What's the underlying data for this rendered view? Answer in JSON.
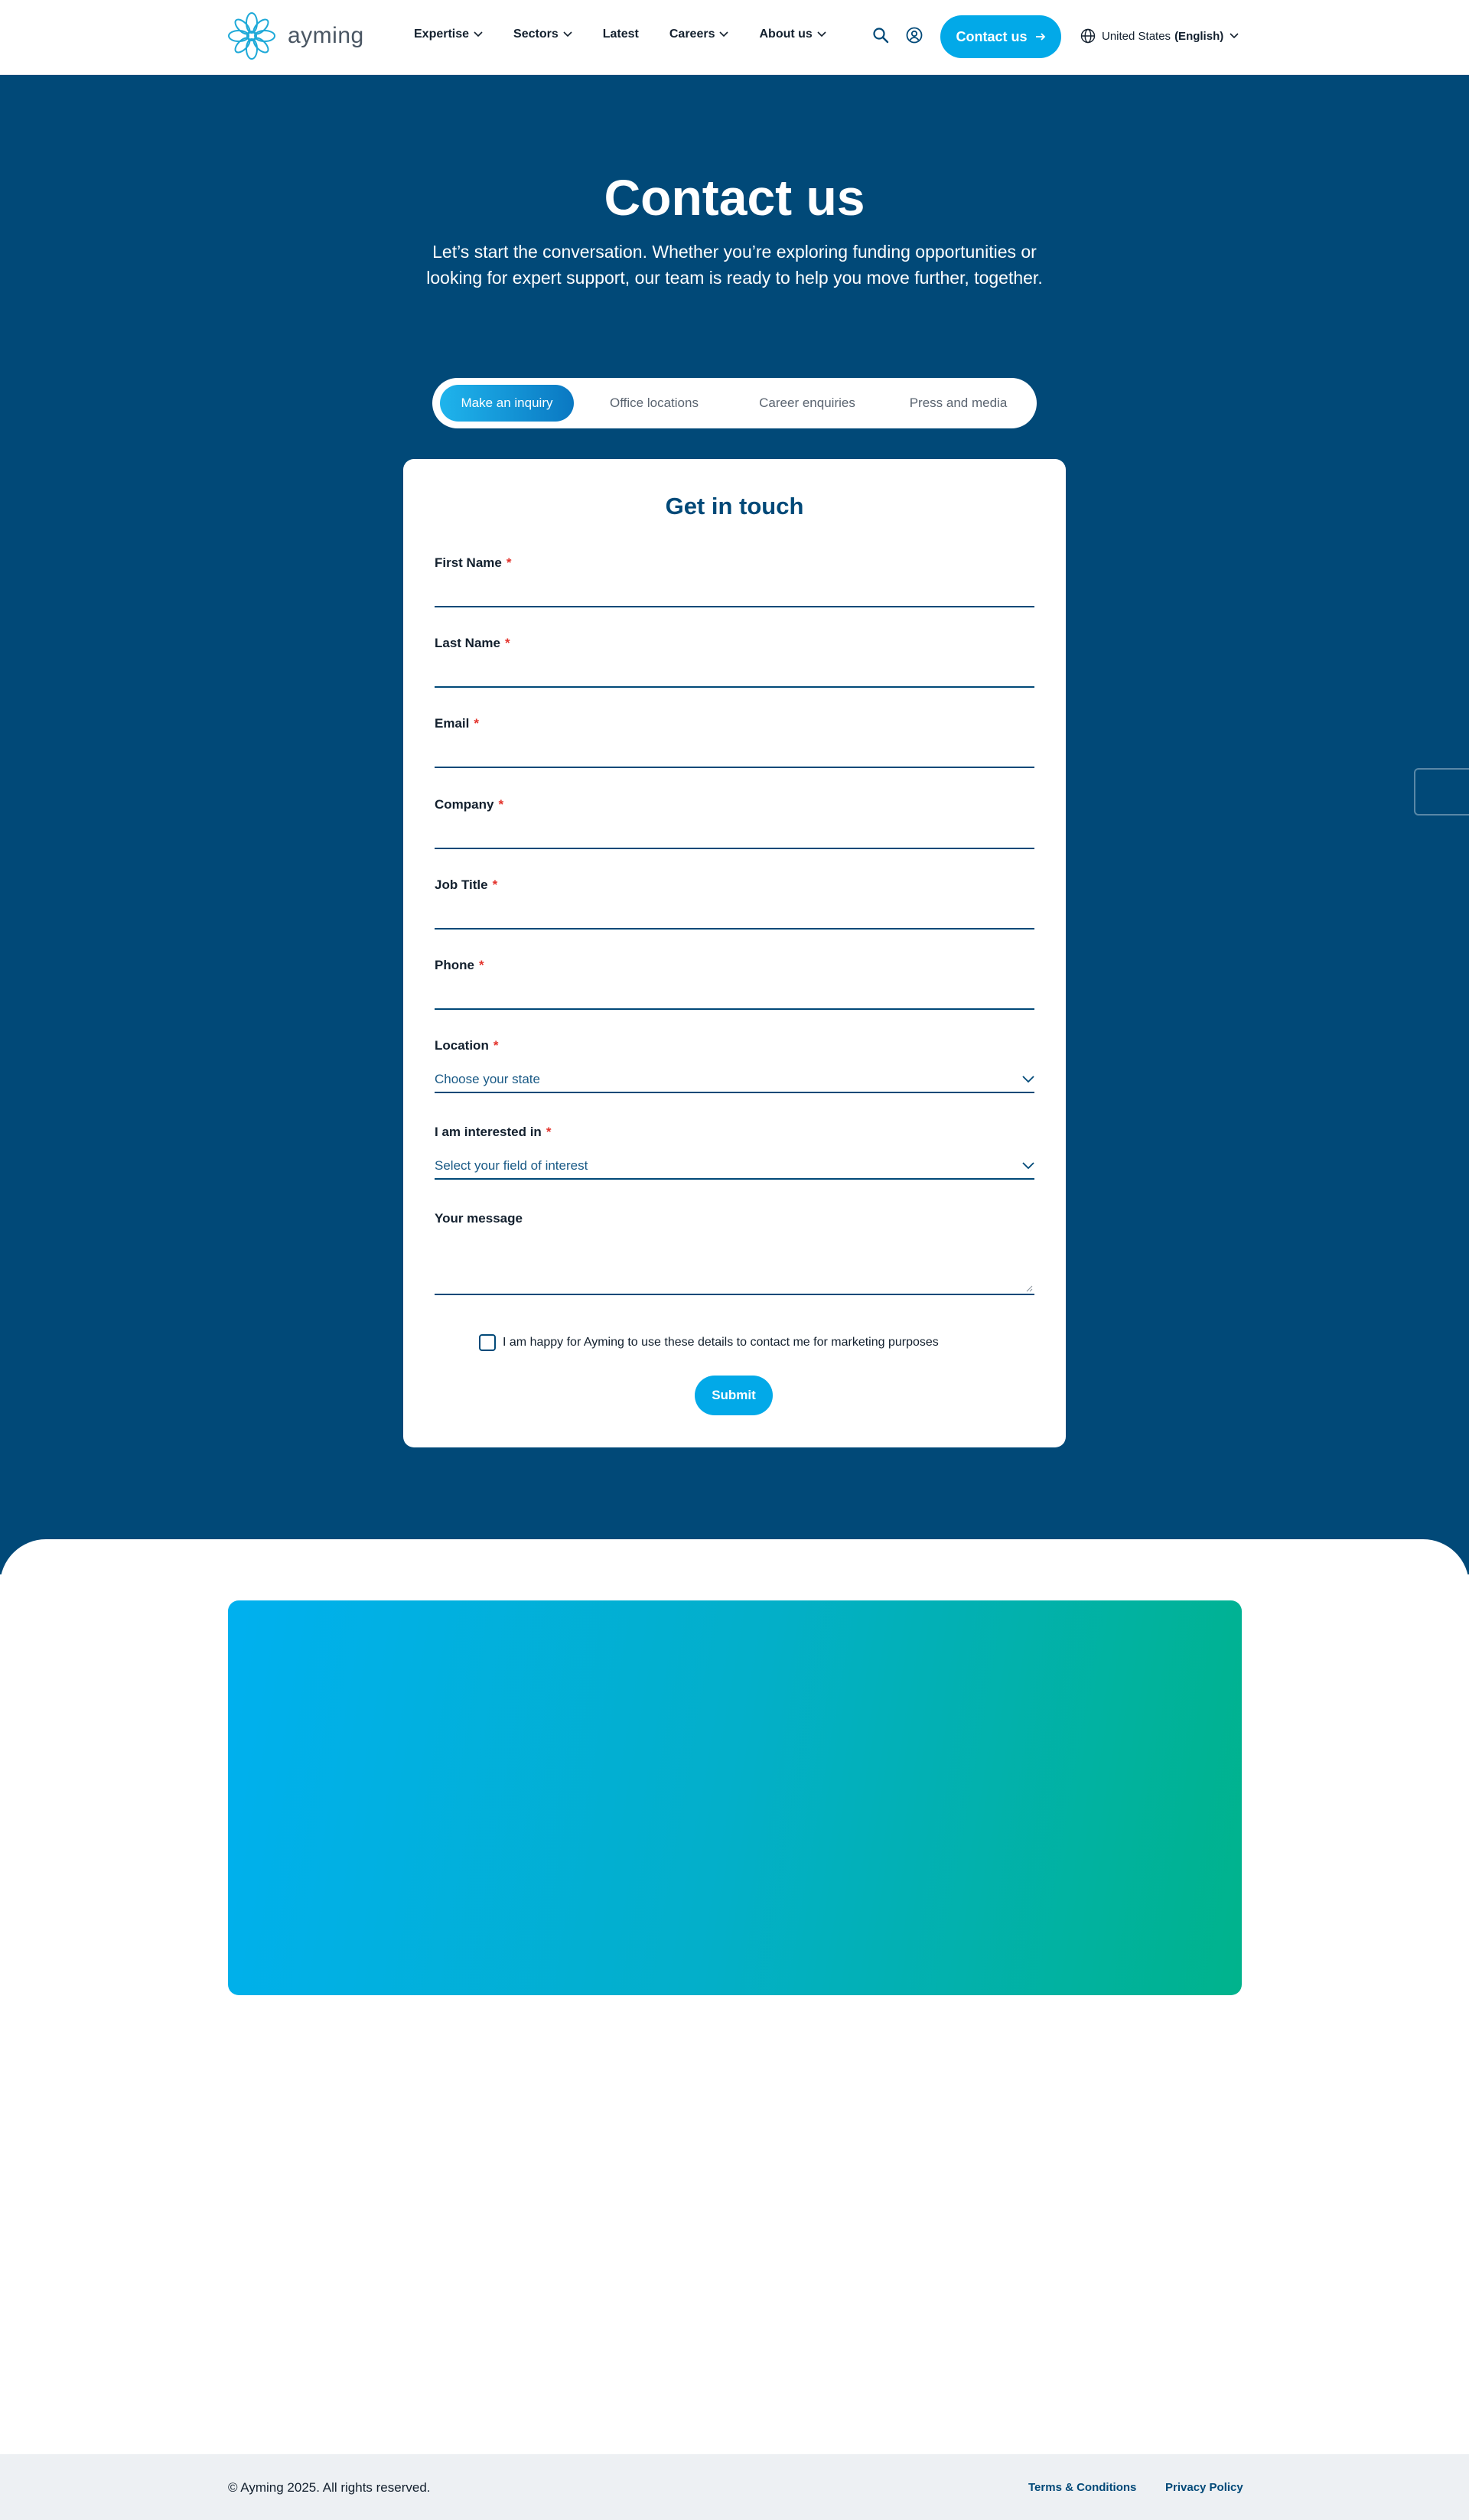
{
  "header": {
    "logo_text": "ayming",
    "nav": [
      {
        "label": "Expertise",
        "has_menu": true
      },
      {
        "label": "Sectors",
        "has_menu": true
      },
      {
        "label": "Latest",
        "has_menu": false
      },
      {
        "label": "Careers",
        "has_menu": true
      },
      {
        "label": "About us",
        "has_menu": true
      }
    ],
    "contact_button": "Contact us",
    "locale_country": "United States",
    "locale_language": "(English)"
  },
  "hero": {
    "title": "Contact us",
    "subtitle": "Let’s start the conversation. Whether you’re exploring funding opportunities or looking for expert support, our team is ready to help you move further, together."
  },
  "tabs": [
    {
      "label": "Make an inquiry",
      "active": true
    },
    {
      "label": "Office locations",
      "active": false
    },
    {
      "label": "Career enquiries",
      "active": false
    },
    {
      "label": "Press and media",
      "active": false
    }
  ],
  "form": {
    "title": "Get in touch",
    "required_marker": "*",
    "fields": {
      "first_name": "First Name",
      "last_name": "Last Name",
      "email": "Email",
      "company": "Company",
      "job_title": "Job Title",
      "phone": "Phone",
      "location": "Location",
      "interest": "I am interested in",
      "message": "Your message"
    },
    "location_placeholder": "Choose your state",
    "interest_placeholder": "Select your field of interest",
    "consent_text": "I am happy for Ayming to use these details to contact me for marketing purposes",
    "submit_label": "Submit"
  },
  "footer": {
    "copyright": "© Ayming 2025. All rights reserved.",
    "terms": "Terms & Conditions",
    "privacy": "Privacy Policy"
  },
  "colors": {
    "brand_navy": "#014978",
    "accent_blue": "#02a9e8",
    "required_red": "#e3322b",
    "banner_start": "#00b0ef",
    "banner_end": "#00b38c"
  }
}
